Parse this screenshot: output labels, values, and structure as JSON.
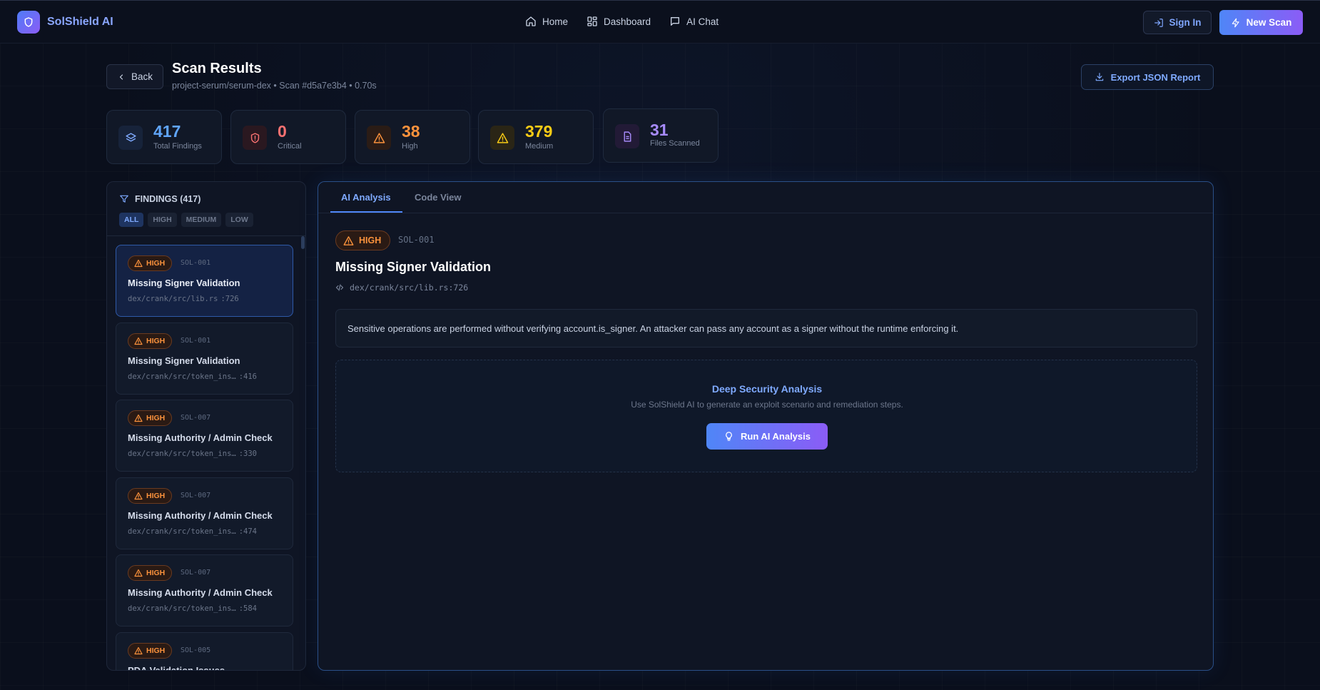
{
  "app": {
    "brand": "SolShield AI",
    "accent": "#4f86f7",
    "accent2": "#8b5cf6"
  },
  "nav": {
    "items": [
      {
        "label": "Home",
        "icon": "home-icon"
      },
      {
        "label": "Dashboard",
        "icon": "dashboard-icon"
      },
      {
        "label": "AI Chat",
        "icon": "chat-icon"
      }
    ],
    "sign_in": "Sign In",
    "new_scan": "New Scan"
  },
  "page": {
    "back_label": "Back",
    "title": "Scan Results",
    "subtitle": "project-serum/serum-dex • Scan #d5a7e3b4 • 0.70s",
    "export_label": "Export JSON Report"
  },
  "stats": [
    {
      "value": "417",
      "label": "Total Findings",
      "color": "#60a5fa",
      "icon": "layers-icon"
    },
    {
      "value": "0",
      "label": "Critical",
      "color": "#f87171",
      "icon": "shield-alert-icon"
    },
    {
      "value": "38",
      "label": "High",
      "color": "#fb923c",
      "icon": "warning-icon"
    },
    {
      "value": "379",
      "label": "Medium",
      "color": "#facc15",
      "icon": "warning-icon"
    },
    {
      "value": "31",
      "label": "Files Scanned",
      "color": "#a78bfa",
      "icon": "file-icon"
    }
  ],
  "findings_panel": {
    "heading": "FINDINGS (417)",
    "filters": [
      "ALL",
      "HIGH",
      "MEDIUM",
      "LOW"
    ],
    "active_filter": "ALL",
    "items": [
      {
        "severity": "HIGH",
        "id": "SOL-001",
        "title": "Missing Signer Validation",
        "path": "dex/crank/src/lib.rs",
        "line": ":726",
        "selected": true
      },
      {
        "severity": "HIGH",
        "id": "SOL-001",
        "title": "Missing Signer Validation",
        "path": "dex/crank/src/token_ins…",
        "line": ":416",
        "selected": false
      },
      {
        "severity": "HIGH",
        "id": "SOL-007",
        "title": "Missing Authority / Admin Check",
        "path": "dex/crank/src/token_ins…",
        "line": ":330",
        "selected": false
      },
      {
        "severity": "HIGH",
        "id": "SOL-007",
        "title": "Missing Authority / Admin Check",
        "path": "dex/crank/src/token_ins…",
        "line": ":474",
        "selected": false
      },
      {
        "severity": "HIGH",
        "id": "SOL-007",
        "title": "Missing Authority / Admin Check",
        "path": "dex/crank/src/token_ins…",
        "line": ":584",
        "selected": false
      },
      {
        "severity": "HIGH",
        "id": "SOL-005",
        "title": "PDA Validation Issues",
        "path": "",
        "line": "",
        "selected": false
      }
    ]
  },
  "detail": {
    "tabs": [
      {
        "label": "AI Analysis",
        "active": true
      },
      {
        "label": "Code View",
        "active": false
      }
    ],
    "severity": "HIGH",
    "id": "SOL-001",
    "title": "Missing Signer Validation",
    "location": "dex/crank/src/lib.rs:726",
    "description": "Sensitive operations are performed without verifying account.is_signer. An attacker can pass any account as a signer without the runtime enforcing it.",
    "deep_title": "Deep Security Analysis",
    "deep_sub": "Use SolShield AI to generate an exploit scenario and remediation steps.",
    "run_label": "Run AI Analysis"
  }
}
